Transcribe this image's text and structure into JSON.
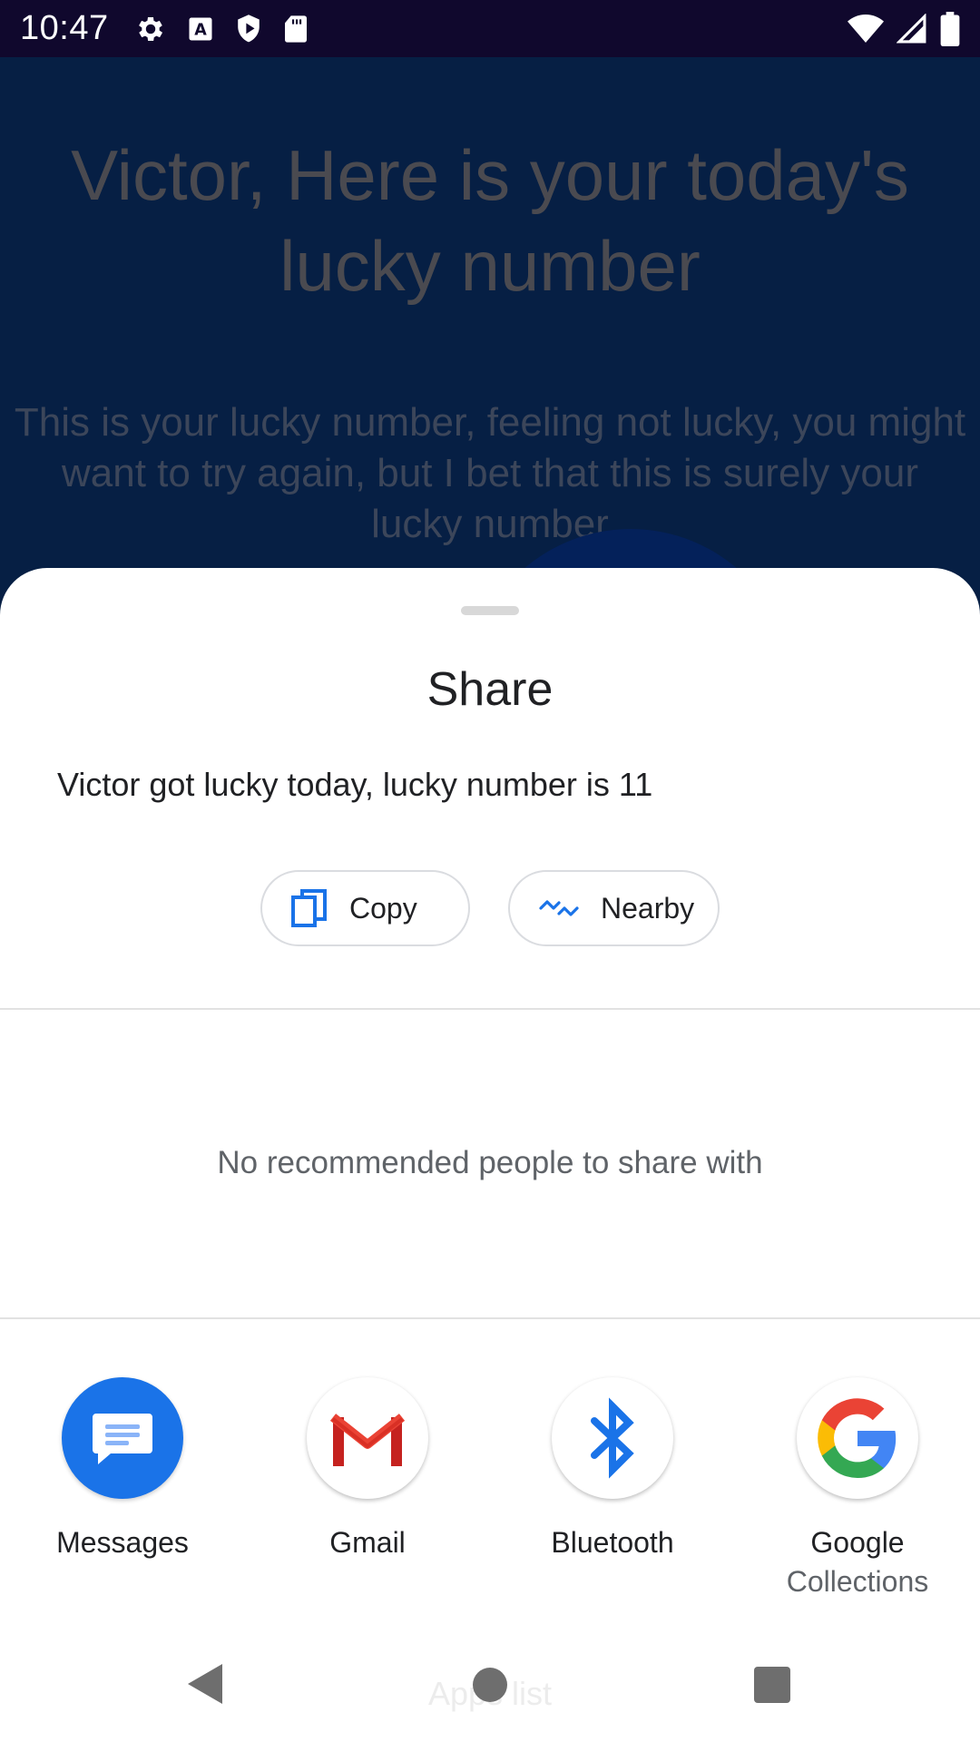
{
  "status_bar": {
    "time": "10:47",
    "left_icons": [
      "gear-icon",
      "font-a-icon",
      "shield-play-icon",
      "sd-card-icon"
    ],
    "right_icons": [
      "wifi-icon",
      "cell-signal-icon",
      "battery-icon"
    ]
  },
  "background_app": {
    "title": "Victor, Here is your today's lucky number",
    "body": "This is your lucky number, feeling not lucky, you might want to try again, but I bet that this is surely your lucky number"
  },
  "share_sheet": {
    "title": "Share",
    "shared_text": "Victor got lucky today, lucky number is 11",
    "chips": {
      "copy": {
        "label": "Copy",
        "icon": "copy-icon"
      },
      "nearby": {
        "label": "Nearby",
        "icon": "nearby-icon"
      }
    },
    "no_recommendations": "No recommended people to share with",
    "apps": [
      {
        "label": "Messages",
        "sublabel": "",
        "icon": "messages-icon"
      },
      {
        "label": "Gmail",
        "sublabel": "",
        "icon": "gmail-icon"
      },
      {
        "label": "Bluetooth",
        "sublabel": "",
        "icon": "bluetooth-icon"
      },
      {
        "label": "Google",
        "sublabel": "Collections",
        "icon": "google-icon"
      }
    ]
  },
  "nav_bar": {
    "ghost_label": "Apps list",
    "buttons": [
      "back-icon",
      "home-icon",
      "recents-icon"
    ]
  },
  "colors": {
    "status_bar": "#10082d",
    "background": "#061f44",
    "accent_blue": "#1a73e8",
    "sheet": "#ffffff"
  }
}
